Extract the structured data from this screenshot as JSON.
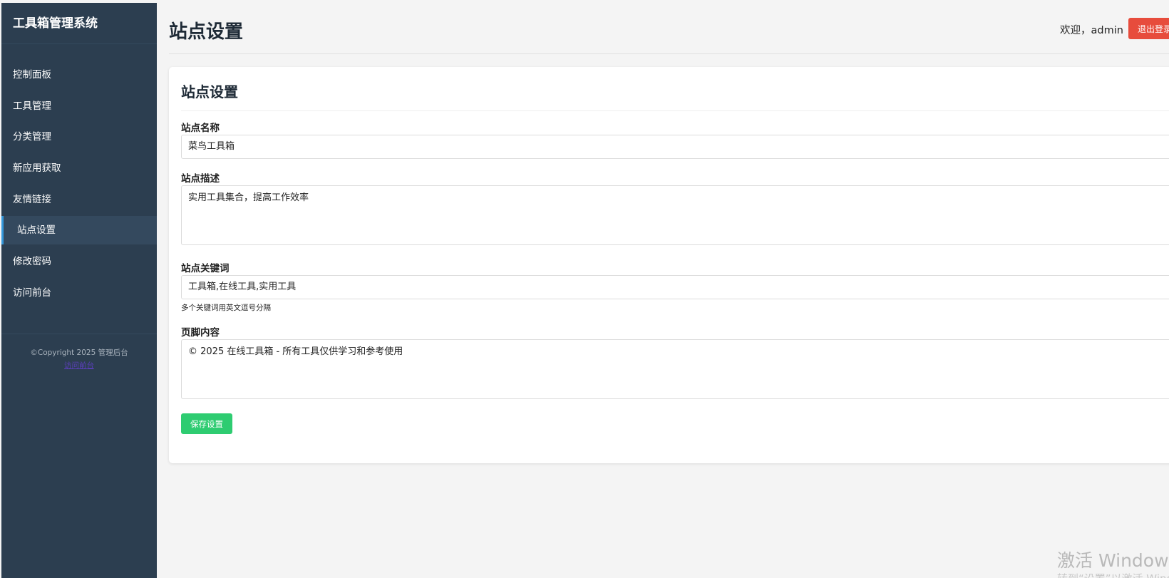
{
  "sidebar": {
    "title": "工具箱管理系统",
    "items": [
      {
        "label": "控制面板"
      },
      {
        "label": "工具管理"
      },
      {
        "label": "分类管理"
      },
      {
        "label": "新应用获取"
      },
      {
        "label": "友情链接"
      },
      {
        "label": "站点设置"
      },
      {
        "label": "修改密码"
      },
      {
        "label": "访问前台"
      }
    ],
    "copyright": "©Copyright 2025 管理后台",
    "copyright_link": "访问前台"
  },
  "header": {
    "title": "站点设置",
    "welcome": "欢迎，admin",
    "logout_label": "退出登录"
  },
  "form": {
    "card_title": "站点设置",
    "site_name": {
      "label": "站点名称",
      "value": "菜鸟工具箱"
    },
    "site_description": {
      "label": "站点描述",
      "value": "实用工具集合，提高工作效率"
    },
    "site_keywords": {
      "label": "站点关键词",
      "value": "工具箱,在线工具,实用工具",
      "hint": "多个关键词用英文逗号分隔"
    },
    "footer_content": {
      "label": "页脚内容",
      "value": "© 2025 在线工具箱 - 所有工具仅供学习和参考使用"
    },
    "save_label": "保存设置"
  },
  "watermark": {
    "line1": "激活 Windows",
    "line2": "转到“设置”以激活 Windows。"
  },
  "colors": {
    "sidebar_bg": "#2c3e50",
    "active_accent": "#3498db",
    "logout_bg": "#e74c3c",
    "save_bg": "#2ecc71"
  }
}
